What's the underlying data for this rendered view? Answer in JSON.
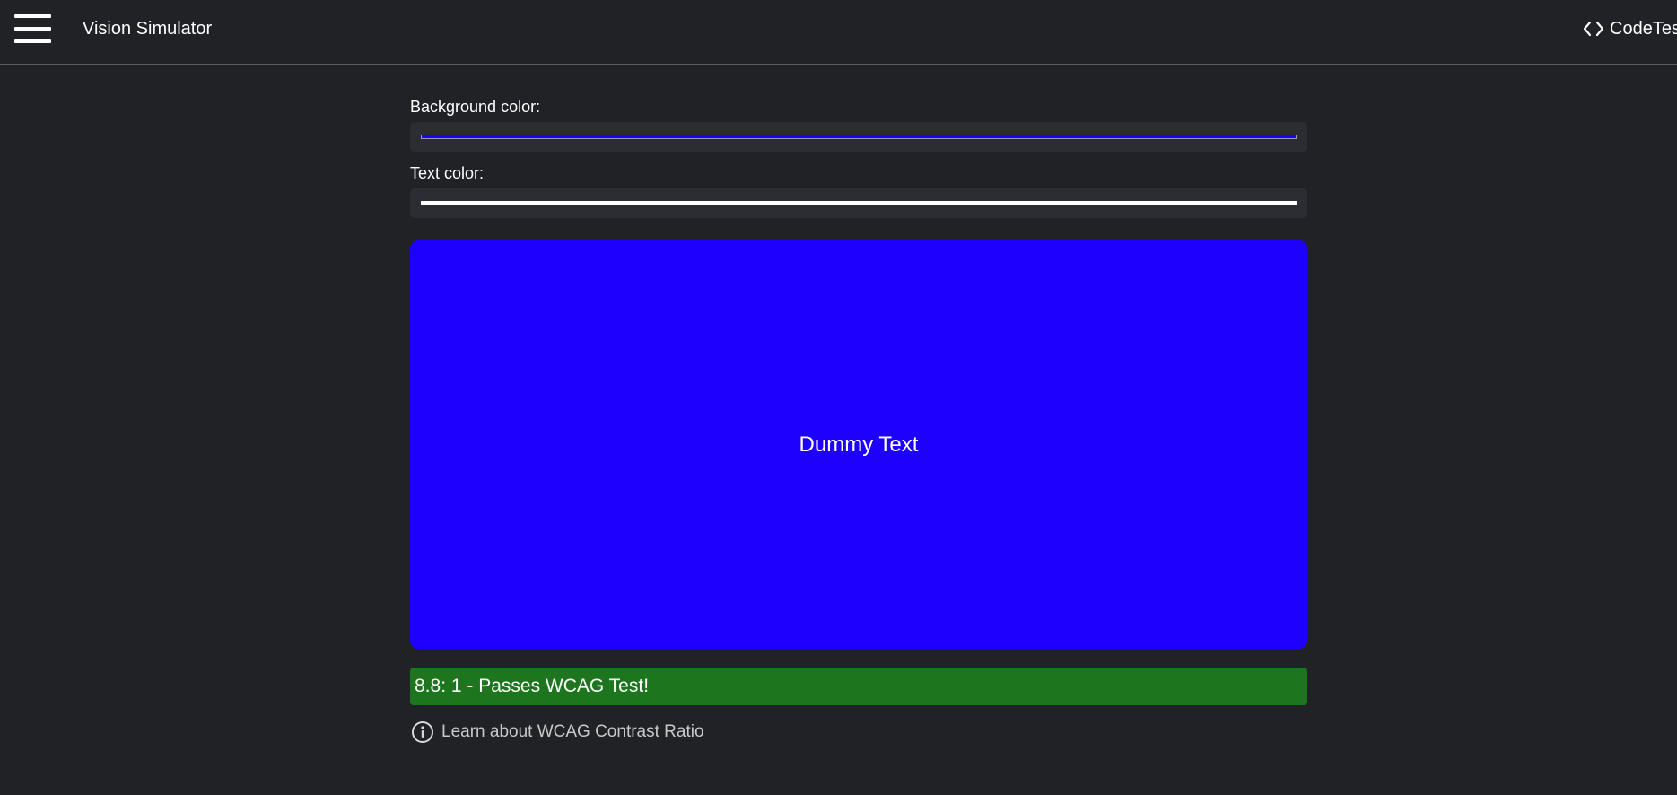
{
  "header": {
    "menu_icon": "hamburger-menu-icon",
    "app_title": "Vision Simulator",
    "brand_icon": "code-brackets-icon",
    "brand_label": "CodeTesc"
  },
  "form": {
    "background_label": "Background color:",
    "background_value": "#1e00ff",
    "text_label": "Text color:",
    "text_value": "#ffffff"
  },
  "preview": {
    "text": "Dummy Text",
    "background_color": "#1e00ff",
    "text_color": "#ffffff"
  },
  "result": {
    "text": "8.8: 1 - Passes WCAG Test!",
    "status_color": "#1d761e"
  },
  "info": {
    "icon": "info-circle-icon",
    "link_text": "Learn about WCAG Contrast Ratio"
  }
}
